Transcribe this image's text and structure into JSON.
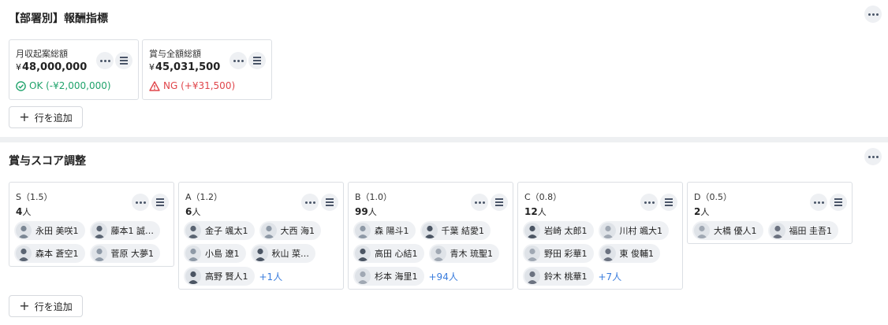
{
  "compensation": {
    "title": "【部署別】報酬指標",
    "cards": [
      {
        "label": "月収起案総額",
        "currency": "¥",
        "value": "48,000,000",
        "status_type": "ok",
        "status_text": "OK (-¥2,000,000)"
      },
      {
        "label": "賞与全額総額",
        "currency": "¥",
        "value": "45,031,500",
        "status_type": "ng",
        "status_text": "NG (+¥31,500)"
      }
    ],
    "add_row_label": "行を追加"
  },
  "bonus": {
    "title": "賞与スコア調整",
    "add_row_label": "行を追加",
    "grades": [
      {
        "grade": "S（1.5）",
        "count": "4",
        "unit": "人",
        "rows": [
          [
            "永田 美咲1",
            "藤本1 誠…"
          ],
          [
            "森本 蒼空1",
            "菅原 大夢1"
          ]
        ],
        "more": ""
      },
      {
        "grade": "A（1.2）",
        "count": "6",
        "unit": "人",
        "rows": [
          [
            "金子 颯太1",
            "大西 海1"
          ],
          [
            "小島 遼1",
            "秋山 菜…"
          ],
          [
            "高野 賢人1"
          ]
        ],
        "more": "+1人"
      },
      {
        "grade": "B（1.0）",
        "count": "99",
        "unit": "人",
        "rows": [
          [
            "森 陽斗1",
            "千葉 結愛1"
          ],
          [
            "高田 心結1",
            "青木 琉聖1"
          ],
          [
            "杉本 海里1"
          ]
        ],
        "more": "+94人"
      },
      {
        "grade": "C（0.8）",
        "count": "12",
        "unit": "人",
        "rows": [
          [
            "岩崎 太郎1",
            "川村 颯大1"
          ],
          [
            "野田 彩華1",
            "東 俊輔1"
          ],
          [
            "鈴木 桃華1"
          ]
        ],
        "more": "+7人"
      },
      {
        "grade": "D（0.5）",
        "count": "2",
        "unit": "人",
        "rows": [
          [
            "大橋 優人1",
            "福田 圭吾1"
          ]
        ],
        "more": ""
      }
    ]
  },
  "colors": {
    "ok": "#1fa36b",
    "ng": "#e0454a",
    "link": "#3b7ddd"
  },
  "icons": {
    "more_button": "more-dots-icon",
    "menu_button": "menu-lines-icon",
    "ok_status": "check-circle-icon",
    "ng_status": "warning-triangle-icon",
    "add": "plus-icon"
  }
}
